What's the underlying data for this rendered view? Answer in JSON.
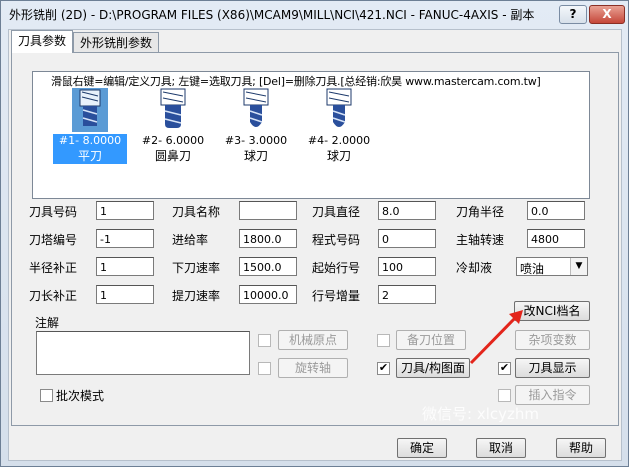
{
  "window": {
    "title": "外形铣削 (2D) - D:\\PROGRAM FILES (X86)\\MCAM9\\MILL\\NCI\\421.NCI - FANUC-4AXIS - 副本",
    "help": "?",
    "close": "X"
  },
  "tabs": [
    {
      "label": "刀具参数"
    },
    {
      "label": "外形铣削参数"
    }
  ],
  "toolbox": {
    "hint": "滑鼠右键=编辑/定义刀具; 左键=选取刀具; [Del]=删除刀具.[总经销:欣昊 www.mastercam.com.tw]",
    "tools": [
      {
        "line1": "#1- 8.0000",
        "line2": "平刀",
        "icon": "flat-endmill-icon",
        "selected": true
      },
      {
        "line1": "#2- 6.0000",
        "line2": "圆鼻刀",
        "icon": "bull-nose-endmill-icon"
      },
      {
        "line1": "#3- 3.0000",
        "line2": "球刀",
        "icon": "ball-endmill-icon"
      },
      {
        "line1": "#4- 2.0000",
        "line2": "球刀",
        "icon": "ball-endmill-icon"
      }
    ]
  },
  "fields": {
    "tool_number": {
      "label": "刀具号码",
      "value": "1"
    },
    "tool_name": {
      "label": "刀具名称",
      "value": ""
    },
    "tool_diameter": {
      "label": "刀具直径",
      "value": "8.0"
    },
    "corner_radius": {
      "label": "刀角半径",
      "value": "0.0"
    },
    "turret_number": {
      "label": "刀塔编号",
      "value": "-1"
    },
    "feed_rate": {
      "label": "进给率",
      "value": "1800.0"
    },
    "program_number": {
      "label": "程式号码",
      "value": "0"
    },
    "spindle_speed": {
      "label": "主轴转速",
      "value": "4800"
    },
    "diameter_offset": {
      "label": "半径补正",
      "value": "1"
    },
    "plunge_rate": {
      "label": "下刀速率",
      "value": "1500.0"
    },
    "start_seq": {
      "label": "起始行号",
      "value": "100"
    },
    "coolant": {
      "label": "冷却液",
      "value": "喷油"
    },
    "length_offset": {
      "label": "刀长补正",
      "value": "1"
    },
    "retract_rate": {
      "label": "提刀速率",
      "value": "10000.0"
    },
    "seq_increment": {
      "label": "行号增量",
      "value": "2"
    }
  },
  "buttons": {
    "rename_nci": "改NCI档名",
    "home_position": "机械原点",
    "reference_point": "备刀位置",
    "misc_values": "杂项变数",
    "rotary_axis": "旋转轴",
    "tool_plane": "刀具/构图面",
    "tool_display": "刀具显示",
    "canned_text": "插入指令",
    "ok": "确定",
    "cancel": "取消",
    "help": "帮助"
  },
  "checkboxes": {
    "home_position": false,
    "rotary_axis": false,
    "reference_point": false,
    "tool_plane": true,
    "tool_display": true,
    "canned_text": false,
    "batch_mode": false
  },
  "comment": {
    "label": "注解",
    "value": ""
  },
  "batch_mode_label": "批次模式",
  "watermark": "微信号: xlcyzhm"
}
